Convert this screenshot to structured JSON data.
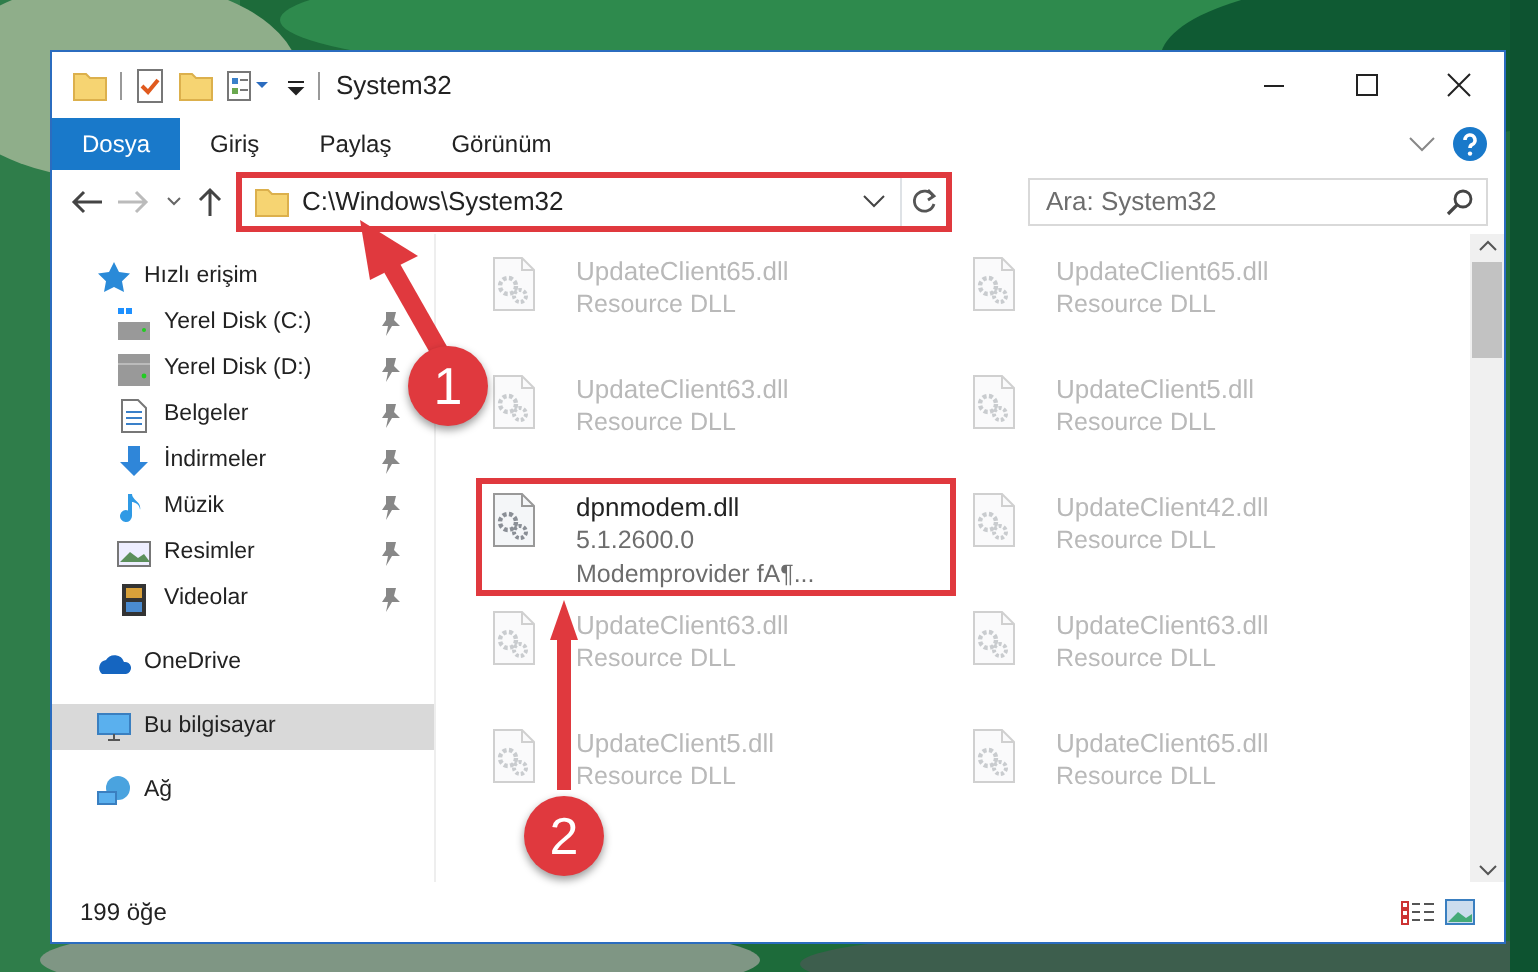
{
  "window": {
    "title": "System32"
  },
  "ribbon_tabs": [
    {
      "label": "Dosya",
      "selected": true
    },
    {
      "label": "Giriş",
      "selected": false
    },
    {
      "label": "Paylaş",
      "selected": false
    },
    {
      "label": "Görünüm",
      "selected": false
    }
  ],
  "address_bar": {
    "path": "C:\\Windows\\System32"
  },
  "search": {
    "placeholder": "Ara: System32"
  },
  "nav_pane": [
    {
      "label": "Hızlı erişim",
      "selected": false,
      "children": [
        {
          "label": "Yerel Disk (C:)",
          "pinned": true
        },
        {
          "label": "Yerel Disk (D:)",
          "pinned": true
        },
        {
          "label": "Belgeler",
          "pinned": true
        },
        {
          "label": "İndirmeler",
          "pinned": true
        },
        {
          "label": "Müzik",
          "pinned": true
        },
        {
          "label": "Resimler",
          "pinned": true
        },
        {
          "label": "Videolar",
          "pinned": true
        }
      ]
    },
    {
      "label": "OneDrive",
      "selected": false
    },
    {
      "label": "Bu bilgisayar",
      "selected": true
    },
    {
      "label": "Ağ",
      "selected": false
    }
  ],
  "files": [
    {
      "name": "UpdateClient65.dll",
      "details": [
        "Resource DLL"
      ],
      "blurred": true
    },
    {
      "name": "UpdateClient65.dll",
      "details": [
        "Resource DLL"
      ],
      "blurred": true
    },
    {
      "name": "UpdateClient63.dll",
      "details": [
        "Resource DLL"
      ],
      "blurred": true
    },
    {
      "name": "UpdateClient5.dll",
      "details": [
        "Resource DLL"
      ],
      "blurred": true
    },
    {
      "name": "dpnmodem.dll",
      "details": [
        "5.1.2600.0",
        "Modemprovider fA¶..."
      ],
      "blurred": false
    },
    {
      "name": "UpdateClient42.dll",
      "details": [
        "Resource DLL"
      ],
      "blurred": true
    },
    {
      "name": "UpdateClient63.dll",
      "details": [
        "Resource DLL"
      ],
      "blurred": true
    },
    {
      "name": "UpdateClient63.dll",
      "details": [
        "Resource DLL"
      ],
      "blurred": true
    },
    {
      "name": "UpdateClient5.dll",
      "details": [
        "Resource DLL"
      ],
      "blurred": true
    },
    {
      "name": "UpdateClient65.dll",
      "details": [
        "Resource DLL"
      ],
      "blurred": true
    }
  ],
  "status_bar": {
    "count": "199 öğe"
  },
  "annotations": [
    {
      "label": "1"
    },
    {
      "label": "2"
    }
  ]
}
